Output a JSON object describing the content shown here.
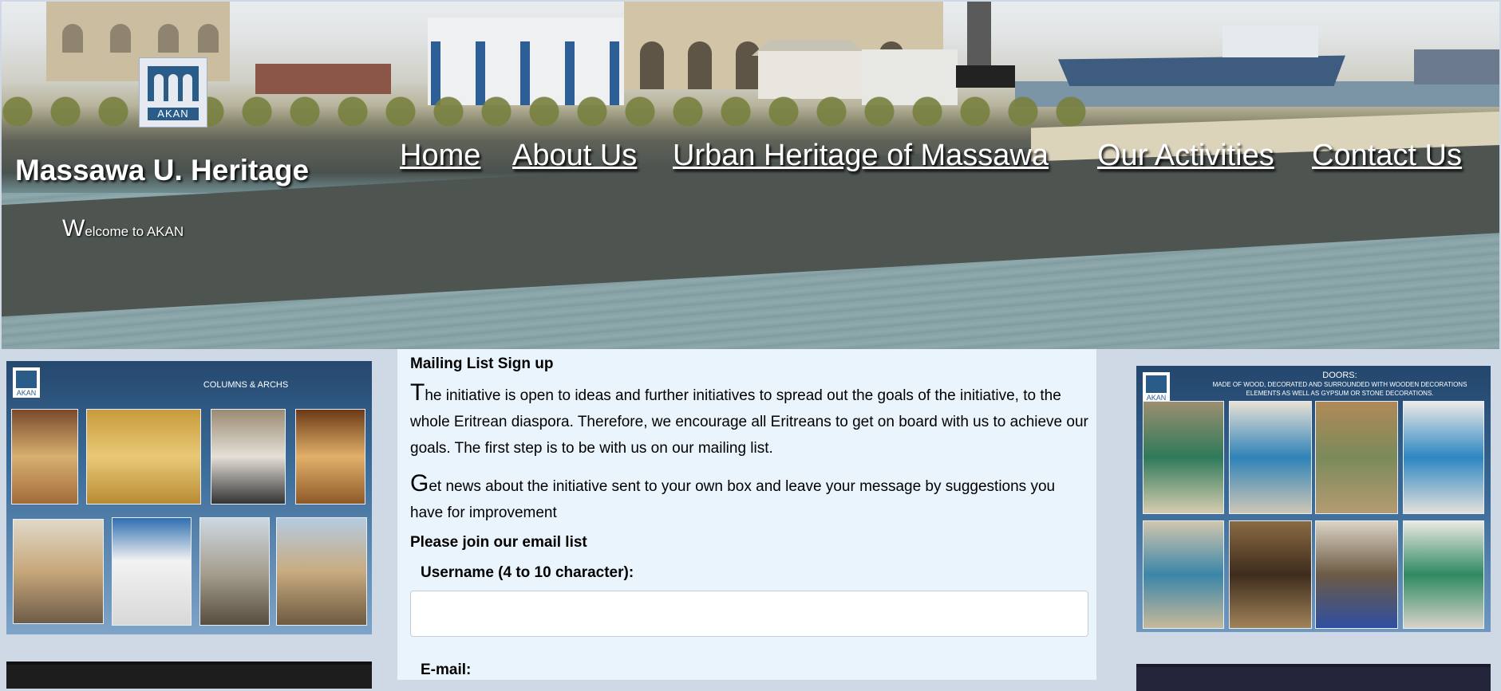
{
  "header": {
    "site_title": "Massawa U. Heritage",
    "logo_text": "AKAN",
    "welcome_first": "W",
    "welcome_rest": "elcome to AKAN",
    "nav": [
      {
        "label": "Home"
      },
      {
        "label": "About Us"
      },
      {
        "label": "Urban Heritage of Massawa"
      },
      {
        "label": "Our Activities"
      },
      {
        "label": "Contact Us"
      }
    ]
  },
  "left_poster": {
    "logo_text": "AKAN",
    "caption": "COLUMNS & ARCHS"
  },
  "right_poster": {
    "logo_text": "AKAN",
    "caption_title": "DOORS:",
    "caption_body": "MADE OF WOOD, DECORATED AND SURROUNDED WITH WOODEN DECORATIONS ELEMENTS AS WELL AS GYPSUM OR STONE DECORATIONS."
  },
  "signup": {
    "heading": "Mailing List Sign up",
    "para1_first": "T",
    "para1_rest": "he initiative is open to ideas and further initiatives to spread out the goals of the initiative, to the whole Eritrean diaspora. Therefore, we encourage all Eritreans to get on board with us to achieve our goals. The first step is to be with us on our mailing list.",
    "para2_first": "G",
    "para2_rest": "et news about the initiative sent to your own box and leave your message by suggestions you have for improvement",
    "join_heading": "Please join our email list",
    "username_label": "Username (4 to 10 character):",
    "username_value": "",
    "email_label": "E-mail:"
  }
}
